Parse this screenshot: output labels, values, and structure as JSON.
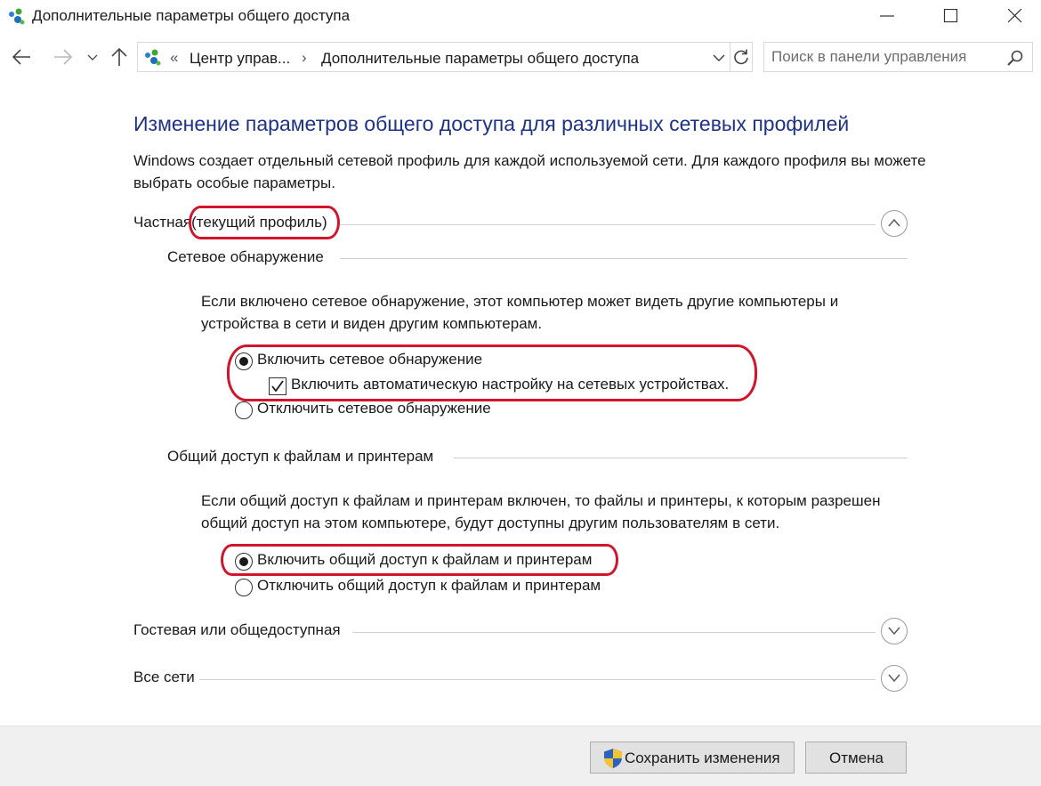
{
  "window": {
    "title": "Дополнительные параметры общего доступа",
    "icon": "network-sharing-icon",
    "controls": [
      "minimize-icon",
      "maximize-icon",
      "close-icon"
    ]
  },
  "navigation": {
    "breadcrumb_overflow": "«",
    "breadcrumb_parent": "Центр управ...",
    "breadcrumb_separator": "›",
    "breadcrumb_current": "Дополнительные параметры общего доступа",
    "search_placeholder": "Поиск в панели управления"
  },
  "main": {
    "title": "Изменение параметров общего доступа для различных сетевых профилей",
    "intro": "Windows создает отдельный сетевой профиль для каждой используемой сети. Для каждого профиля вы можете выбрать особые параметры.",
    "profiles": [
      {
        "name": "Частная",
        "suffix": "(текущий профиль)",
        "expanded": true,
        "sections": [
          {
            "title": "Сетевое обнаружение",
            "description": "Если включено сетевое обнаружение, этот компьютер может видеть другие компьютеры и устройства в сети и виден другим компьютерам.",
            "options": [
              {
                "label": "Включить сетевое обнаружение",
                "type": "radio",
                "checked": true
              },
              {
                "label": "Включить автоматическую настройку на сетевых устройствах.",
                "type": "checkbox",
                "checked": true
              },
              {
                "label": "Отключить сетевое обнаружение",
                "type": "radio",
                "checked": false
              }
            ]
          },
          {
            "title": "Общий доступ к файлам и принтерам",
            "description": "Если общий доступ к файлам и принтерам включен, то файлы и принтеры, к которым разрешен общий доступ на этом компьютере, будут доступны другим пользователям в сети.",
            "options": [
              {
                "label": "Включить общий доступ к файлам и принтерам",
                "type": "radio",
                "checked": true
              },
              {
                "label": "Отключить общий доступ к файлам и принтерам",
                "type": "radio",
                "checked": false
              }
            ]
          }
        ]
      },
      {
        "name": "Гостевая или общедоступная",
        "expanded": false
      },
      {
        "name": "Все сети",
        "expanded": false
      }
    ]
  },
  "footer": {
    "save_label": "Сохранить изменения",
    "cancel_label": "Отмена"
  },
  "colors": {
    "title_blue": "#1e3287",
    "highlight_red": "#d0152c",
    "footer_bg": "#f0f0f0"
  }
}
